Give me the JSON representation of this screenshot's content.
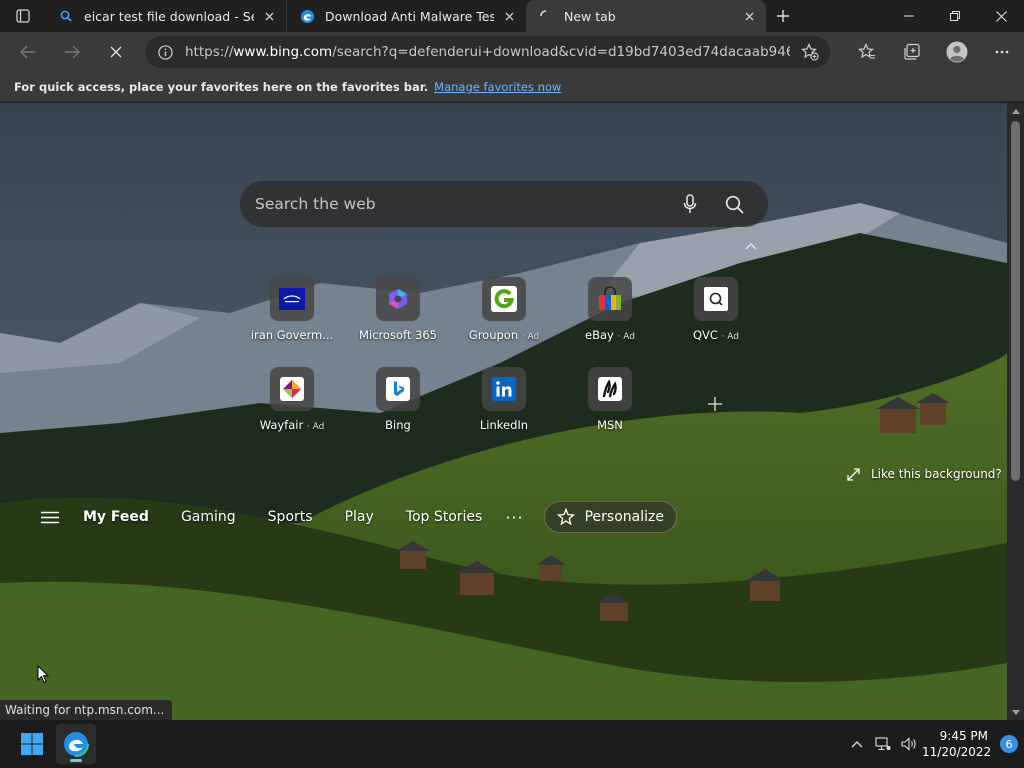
{
  "tabs": [
    {
      "label": "eicar test file download - Search",
      "icon": "search-icon",
      "active": false
    },
    {
      "label": "Download Anti Malware Testfile -",
      "icon": "edge-icon",
      "active": false
    },
    {
      "label": "New tab",
      "icon": "loading-spinner-icon",
      "active": true
    }
  ],
  "toolbar": {
    "url_prefix": "https://",
    "url_host": "www.bing.com",
    "url_path": "/search?q=defenderui+download&cvid=d19bd7403ed74dacaab946c37f..."
  },
  "favorites_bar": {
    "message": "For quick access, place your favorites here on the favorites bar.",
    "link": "Manage favorites now"
  },
  "search": {
    "placeholder": "Search the web"
  },
  "quick_links": [
    {
      "name": "iran Goverm...",
      "ad": ""
    },
    {
      "name": "Microsoft 365",
      "ad": ""
    },
    {
      "name": "Groupon",
      "ad": "· Ad"
    },
    {
      "name": "eBay",
      "ad": "· Ad"
    },
    {
      "name": "QVC",
      "ad": "· Ad"
    },
    {
      "name": "Wayfair",
      "ad": "· Ad"
    },
    {
      "name": "Bing",
      "ad": ""
    },
    {
      "name": "LinkedIn",
      "ad": ""
    },
    {
      "name": "MSN",
      "ad": ""
    }
  ],
  "like_background": "Like this background?",
  "feed": {
    "items": [
      "My Feed",
      "Gaming",
      "Sports",
      "Play",
      "Top Stories"
    ],
    "more": "···",
    "personalize": "Personalize"
  },
  "status": "Waiting for ntp.msn.com...",
  "taskbar": {
    "time": "9:45 PM",
    "date": "11/20/2022",
    "notifications": "6"
  },
  "colors": {
    "accent_link": "#6cb5ff",
    "tab_active": "#3a3a3a",
    "titlebar": "#202020",
    "notification_badge": "#3b8de6"
  }
}
